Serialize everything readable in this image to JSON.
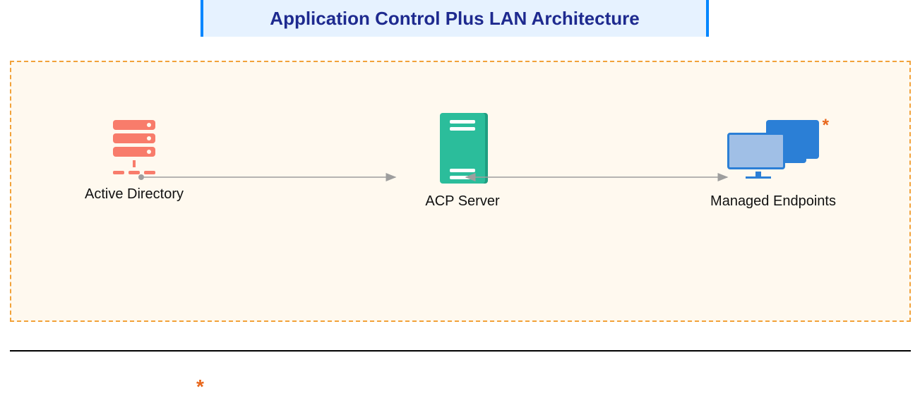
{
  "title": "Application Control Plus LAN Architecture",
  "nodes": {
    "active_directory": {
      "label": "Active Directory"
    },
    "acp_server": {
      "label": "ACP Server"
    },
    "managed_endpoints": {
      "label": "Managed Endpoints",
      "annotation": "*"
    }
  },
  "connections": [
    {
      "from": "active_directory",
      "to": "acp_server",
      "direction": "forward"
    },
    {
      "from": "acp_server",
      "to": "managed_endpoints",
      "direction": "bidirectional"
    }
  ],
  "footnote_marker": "*",
  "colors": {
    "title_bg": "#e6f2ff",
    "title_text": "#1e2a8f",
    "title_border": "#0086ff",
    "box_border": "#f2a23a",
    "box_bg": "#fff9ef",
    "ad_icon": "#f87c6b",
    "acp_icon": "#2bbd9b",
    "me_icon": "#2b7fd6",
    "asterisk": "#e8671c",
    "arrow": "#9e9e9e"
  }
}
